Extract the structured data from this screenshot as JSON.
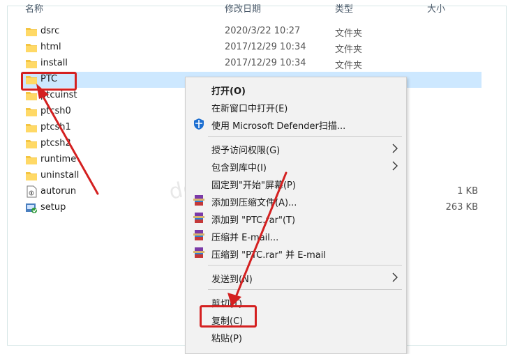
{
  "columns": {
    "name": "名称",
    "date": "修改日期",
    "type": "类型",
    "size": "大小"
  },
  "files": [
    {
      "name": "dsrc",
      "date": "2020/3/22 10:27",
      "type": "文件夹",
      "size": "",
      "icon": "folder-icon"
    },
    {
      "name": "html",
      "date": "2017/12/29 10:34",
      "type": "文件夹",
      "size": "",
      "icon": "folder-icon"
    },
    {
      "name": "install",
      "date": "2017/12/29 10:34",
      "type": "文件夹",
      "size": "",
      "icon": "folder-icon"
    },
    {
      "name": "PTC",
      "date": "",
      "type": "",
      "size": "",
      "icon": "folder-icon",
      "selected": true
    },
    {
      "name": "ptcuinst",
      "date": "",
      "type": "",
      "size": "",
      "icon": "folder-icon"
    },
    {
      "name": "ptcsh0",
      "date": "",
      "type": "",
      "size": "",
      "icon": "folder-icon"
    },
    {
      "name": "ptcsh1",
      "date": "",
      "type": "",
      "size": "",
      "icon": "folder-icon"
    },
    {
      "name": "ptcsh2",
      "date": "",
      "type": "",
      "size": "",
      "icon": "folder-icon"
    },
    {
      "name": "runtime",
      "date": "",
      "type": "",
      "size": "",
      "icon": "folder-icon"
    },
    {
      "name": "uninstall",
      "date": "",
      "type": "",
      "size": "",
      "icon": "folder-icon"
    },
    {
      "name": "autorun",
      "date": "",
      "type": "",
      "size": "1 KB",
      "icon": "autorun-file-icon"
    },
    {
      "name": "setup",
      "date": "",
      "type": "",
      "size": "263 KB",
      "icon": "setup-exe-icon"
    }
  ],
  "context_menu": {
    "groups": [
      [
        {
          "label": "打开(O)",
          "bold": true,
          "icon": ""
        },
        {
          "label": "在新窗口中打开(E)",
          "icon": ""
        },
        {
          "label": "使用 Microsoft Defender扫描...",
          "icon": "defender-shield-icon"
        }
      ],
      [
        {
          "label": "授予访问权限(G)",
          "icon": "",
          "submenu": true
        },
        {
          "label": "包含到库中(I)",
          "icon": "",
          "submenu": true
        },
        {
          "label": "固定到\"开始\"屏幕(P)",
          "icon": ""
        },
        {
          "label": "添加到压缩文件(A)...",
          "icon": "winrar-icon"
        },
        {
          "label": "添加到 \"PTC.rar\"(T)",
          "icon": "winrar-icon"
        },
        {
          "label": "压缩并 E-mail...",
          "icon": "winrar-icon"
        },
        {
          "label": "压缩到 \"PTC.rar\" 并 E-mail",
          "icon": "winrar-icon"
        }
      ],
      [
        {
          "label": "发送到(N)",
          "icon": "",
          "submenu": true
        }
      ],
      [
        {
          "label": "剪切(T)",
          "icon": ""
        },
        {
          "label": "复制(C)",
          "icon": "",
          "highlighted": true
        },
        {
          "label": "粘贴(P)",
          "icon": ""
        }
      ]
    ]
  },
  "watermark": "developerdream",
  "colors": {
    "selection": "#cde8ff",
    "annotation_red": "#d42020",
    "folder_yellow": "#f4c542",
    "menu_bg": "#f2f2f2"
  }
}
